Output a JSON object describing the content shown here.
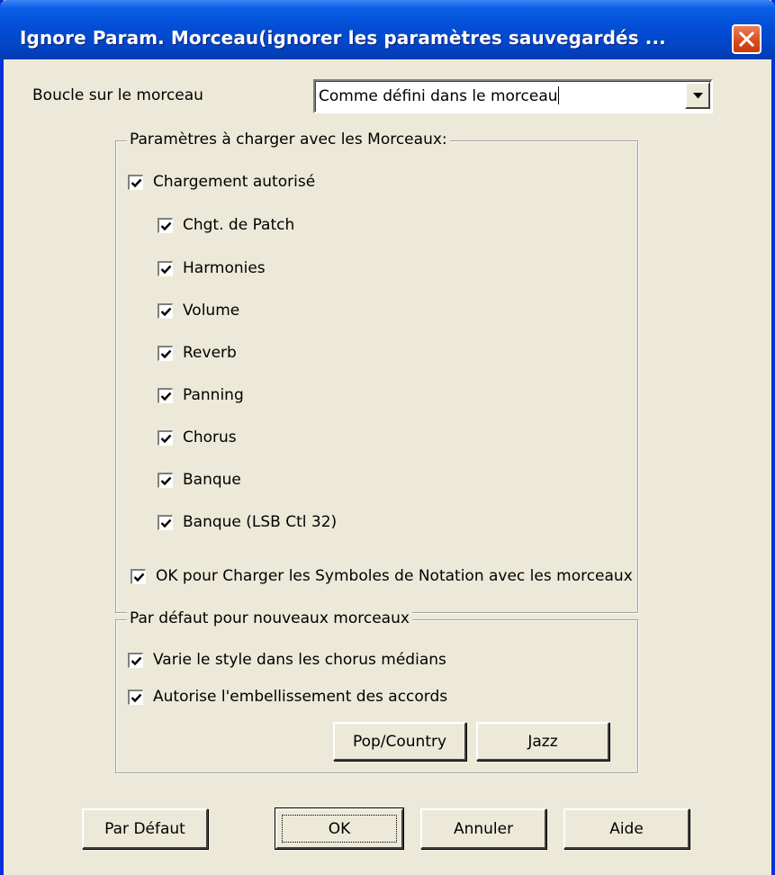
{
  "window": {
    "title": "Ignore Param. Morceau(ignorer les paramètres sauvegardés ...",
    "close_icon": "close-icon"
  },
  "loop": {
    "label": "Boucle sur le morceau",
    "value": "Comme défini dans le morceau"
  },
  "load_group": {
    "title": "Paramètres à charger avec les Morceaux:",
    "master": {
      "label": "Chargement autorisé",
      "checked": true
    },
    "items": [
      {
        "label": "Chgt. de Patch",
        "checked": true
      },
      {
        "label": "Harmonies",
        "checked": true
      },
      {
        "label": "Volume",
        "checked": true
      },
      {
        "label": "Reverb",
        "checked": true
      },
      {
        "label": "Panning",
        "checked": true
      },
      {
        "label": "Chorus",
        "checked": true
      },
      {
        "label": "Banque",
        "checked": true
      },
      {
        "label": "Banque (LSB Ctl 32)",
        "checked": true
      }
    ]
  },
  "notation": {
    "label": "OK pour Charger les Symboles de Notation avec les morceaux",
    "checked": true
  },
  "defaults_group": {
    "title": "Par défaut pour nouveaux morceaux",
    "vary_style": {
      "label": "Varie le style dans les chorus médians",
      "checked": true
    },
    "embellish": {
      "label": "Autorise l'embellissement des accords",
      "checked": true
    },
    "pop_button": "Pop/Country",
    "jazz_button": "Jazz"
  },
  "footer": {
    "default_button": "Par Défaut",
    "ok_button": "OK",
    "cancel_button": "Annuler",
    "help_button": "Aide"
  }
}
